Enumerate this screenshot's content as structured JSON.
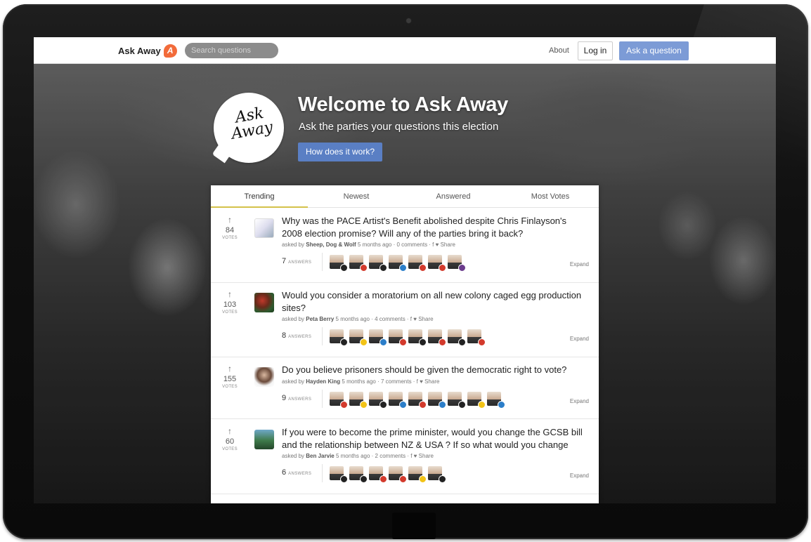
{
  "navbar": {
    "brand": "Ask Away",
    "brand_logo_letter": "A",
    "search_placeholder": "Search questions",
    "about": "About",
    "login": "Log in",
    "ask": "Ask a question"
  },
  "hero": {
    "logo_text_1": "Ask",
    "logo_text_2": "Away",
    "title": "Welcome to Ask Away",
    "subtitle": "Ask the parties your questions this election",
    "button": "How does it work?"
  },
  "tabs": [
    {
      "label": "Trending",
      "active": true
    },
    {
      "label": "Newest",
      "active": false
    },
    {
      "label": "Answered",
      "active": false
    },
    {
      "label": "Most Votes",
      "active": false
    }
  ],
  "labels": {
    "votes": "VOTES",
    "answers": "ANSWERS",
    "expand": "Expand",
    "asked_by": "asked by"
  },
  "colors": {
    "accent": "#7c9bd6",
    "tab_underline": "#d4c24a",
    "brand_logo": "#f26b3a",
    "badge_red": "#d33a2c",
    "badge_blue": "#2b7ec9",
    "badge_yellow": "#f2c316",
    "badge_purple": "#6b3b8c",
    "badge_black": "#222222",
    "badge_green": "#3a9a3a"
  },
  "questions": [
    {
      "votes": "84",
      "title": "Why was the PACE Artist's Benefit abolished despite Chris Finlayson's 2008 election promise? Will any of the parties bring it back?",
      "asker": "Sheep, Dog & Wolf",
      "meta": "5 months ago · 0 comments · f ♥ Share",
      "answer_count": "7",
      "badges": [
        "black",
        "red",
        "black",
        "blue",
        "red",
        "red",
        "purple"
      ]
    },
    {
      "votes": "103",
      "title": "Would you consider a moratorium on all new colony caged egg production sites?",
      "asker": "Peta Berry",
      "meta": "5 months ago · 4 comments · f ♥ Share",
      "answer_count": "8",
      "badges": [
        "black",
        "yellow",
        "blue",
        "red",
        "black",
        "red",
        "black",
        "red"
      ]
    },
    {
      "votes": "155",
      "title": "Do you believe prisoners should be given the democratic right to vote?",
      "asker": "Hayden King",
      "meta": "5 months ago · 7 comments · f ♥ Share",
      "answer_count": "9",
      "badges": [
        "red",
        "yellow",
        "black",
        "blue",
        "red",
        "blue",
        "black",
        "yellow",
        "blue"
      ]
    },
    {
      "votes": "60",
      "title": "If you were to become the prime minister, would you change the GCSB bill and the relationship between NZ & USA ? If so what would you change",
      "asker": "Ben Jarvie",
      "meta": "5 months ago · 2 comments · f ♥ Share",
      "answer_count": "6",
      "badges": [
        "black",
        "black",
        "red",
        "red",
        "yellow",
        "black"
      ]
    }
  ]
}
